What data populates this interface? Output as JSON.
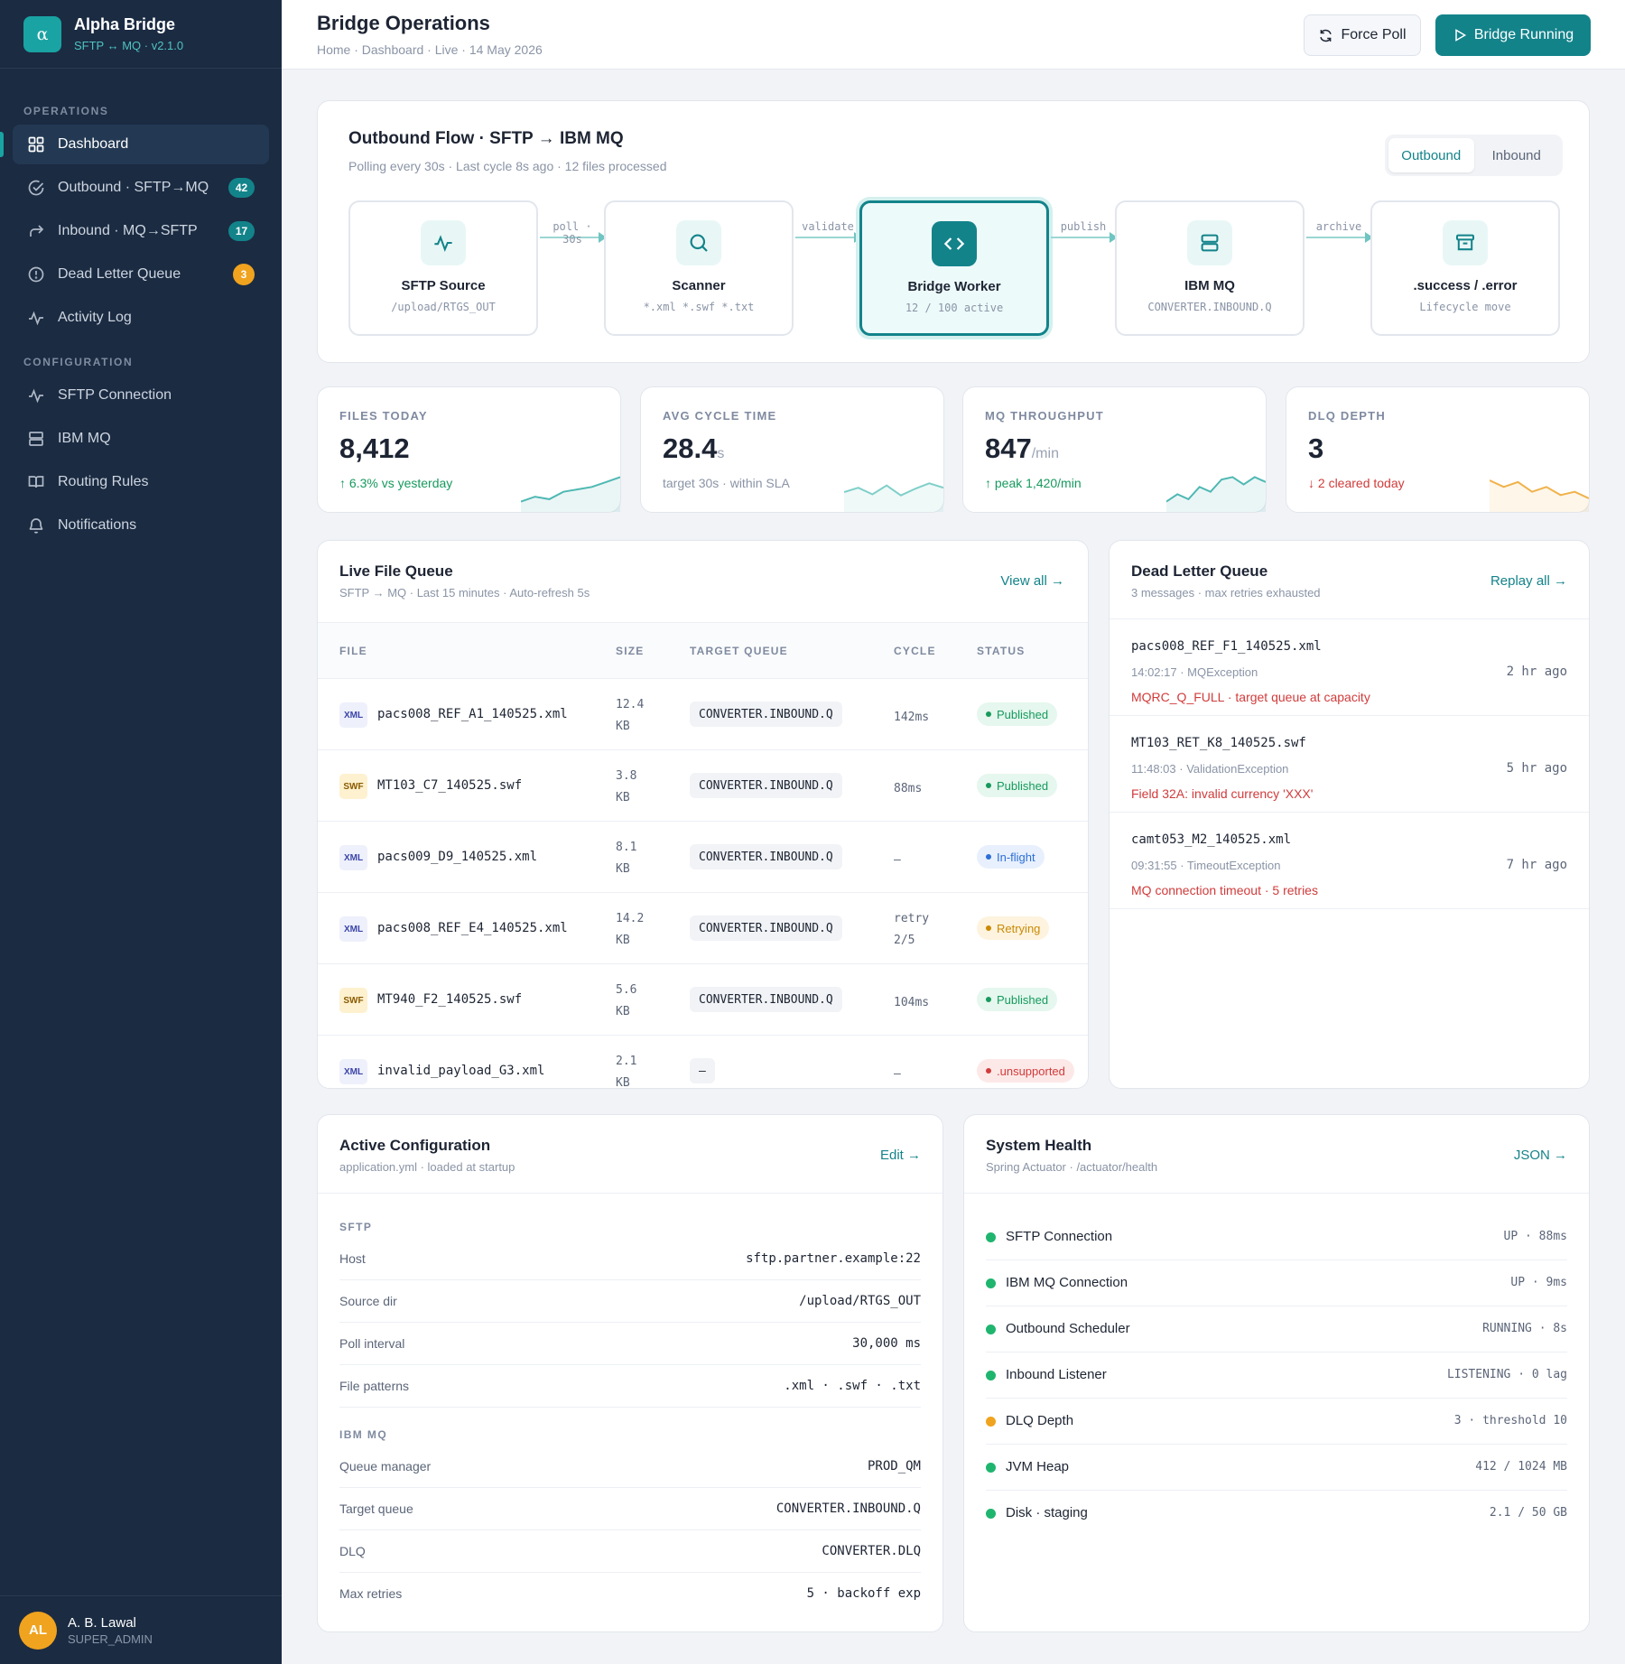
{
  "app": {
    "logo_glyph": "α",
    "name": "Alpha Bridge",
    "subtitle": "SFTP ↔ MQ · v2.1.0"
  },
  "sidebar": {
    "sections": [
      {
        "title": "OPERATIONS",
        "items": [
          {
            "label": "Dashboard",
            "icon": "grid-icon",
            "active": true
          },
          {
            "label": "Outbound · SFTP→MQ",
            "icon": "check-circle-icon",
            "badge": "42"
          },
          {
            "label": "Inbound · MQ→SFTP",
            "icon": "forward-arrow-icon",
            "badge": "17"
          },
          {
            "label": "Dead Letter Queue",
            "icon": "alert-circle-icon",
            "badge": "3"
          },
          {
            "label": "Activity Log",
            "icon": "activity-icon"
          }
        ]
      },
      {
        "title": "CONFIGURATION",
        "items": [
          {
            "label": "SFTP Connection",
            "icon": "pulse-icon"
          },
          {
            "label": "IBM MQ",
            "icon": "server-icon"
          },
          {
            "label": "Routing Rules",
            "icon": "book-icon"
          },
          {
            "label": "Notifications",
            "icon": "bell-icon"
          }
        ]
      }
    ],
    "user": {
      "initials": "AL",
      "name": "A. B. Lawal",
      "role": "SUPER_ADMIN"
    }
  },
  "header": {
    "title": "Bridge Operations",
    "breadcrumb": "Home · Dashboard · Live · 14 May 2026",
    "force_poll_label": "Force Poll",
    "running_label": "Bridge Running"
  },
  "flow": {
    "title": "Outbound Flow · SFTP → IBM MQ",
    "subtitle": "Polling every 30s · Last cycle 8s ago · 12 files processed",
    "toggle": {
      "outbound": "Outbound",
      "inbound": "Inbound",
      "selected": "Outbound"
    },
    "nodes": [
      {
        "name": "SFTP Source",
        "sub": "/upload/RTGS_OUT",
        "icon": "activity-icon"
      },
      {
        "name": "Scanner",
        "sub": "*.xml *.swf *.txt",
        "icon": "search-icon"
      },
      {
        "name": "Bridge Worker",
        "sub": "12 / 100 active",
        "icon": "code-icon"
      },
      {
        "name": "IBM MQ",
        "sub": "CONVERTER.INBOUND.Q",
        "icon": "server-icon"
      },
      {
        "name": ".success / .error",
        "sub": "Lifecycle move",
        "icon": "archive-icon"
      }
    ],
    "edges": [
      "poll · 30s",
      "validate",
      "publish",
      "archive"
    ]
  },
  "kpis": [
    {
      "label": "FILES TODAY",
      "value": "8,412",
      "unit": "",
      "note": "↑ 6.3% vs yesterday",
      "note_color": "#169a5d",
      "spark_color": "#4fb8b3",
      "spark": [
        3,
        4,
        3.5,
        5,
        5.5,
        6,
        7,
        8
      ]
    },
    {
      "label": "AVG CYCLE TIME",
      "value": "28.4",
      "unit": "s",
      "note": "target 30s · within SLA",
      "note_color": "#8a94a6",
      "spark_color": "#7fcfc9",
      "spark": [
        5,
        5.4,
        4.8,
        5.6,
        4.7,
        5.3,
        5.8,
        5.4
      ]
    },
    {
      "label": "MQ THROUGHPUT",
      "value": "847",
      "unit": "/min",
      "note": "↑ peak 1,420/min",
      "note_color": "#169a5d",
      "spark_color": "#4fb8b3",
      "spark": [
        3,
        4.5,
        3.5,
        6,
        5,
        7.5,
        8,
        6.5,
        8,
        7
      ]
    },
    {
      "label": "DLQ DEPTH",
      "value": "3",
      "unit": "",
      "note": "↓ 2 cleared today",
      "note_color": "#d13b3b",
      "spark_color": "#f0b24a",
      "spark": [
        6,
        5.2,
        5.8,
        4.6,
        5.2,
        4.2,
        4.6,
        3.8
      ]
    }
  ],
  "queue": {
    "title": "Live File Queue",
    "subtitle": "SFTP → MQ · Last 15 minutes · Auto-refresh 5s",
    "link": "View all →",
    "columns": [
      "FILE",
      "SIZE",
      "TARGET QUEUE",
      "CYCLE",
      "STATUS"
    ],
    "rows": [
      {
        "type": "XML",
        "file": "pacs008_REF_A1_140525.xml",
        "size1": "12.4",
        "size2": "KB",
        "queue": "CONVERTER.INBOUND.Q",
        "cycle1": "142ms",
        "cycle2": "",
        "status": "Published",
        "status_class": "published"
      },
      {
        "type": "SWF",
        "file": "MT103_C7_140525.swf",
        "size1": "3.8",
        "size2": "KB",
        "queue": "CONVERTER.INBOUND.Q",
        "cycle1": "88ms",
        "cycle2": "",
        "status": "Published",
        "status_class": "published"
      },
      {
        "type": "XML",
        "file": "pacs009_D9_140525.xml",
        "size1": "8.1",
        "size2": "KB",
        "queue": "CONVERTER.INBOUND.Q",
        "cycle1": "—",
        "cycle2": "",
        "status": "In-flight",
        "status_class": "inflight"
      },
      {
        "type": "XML",
        "file": "pacs008_REF_E4_140525.xml",
        "size1": "14.2",
        "size2": "KB",
        "queue": "CONVERTER.INBOUND.Q",
        "cycle1": "retry",
        "cycle2": "2/5",
        "status": "Retrying",
        "status_class": "retrying"
      },
      {
        "type": "SWF",
        "file": "MT940_F2_140525.swf",
        "size1": "5.6",
        "size2": "KB",
        "queue": "CONVERTER.INBOUND.Q",
        "cycle1": "104ms",
        "cycle2": "",
        "status": "Published",
        "status_class": "published"
      },
      {
        "type": "XML",
        "file": "invalid_payload_G3.xml",
        "size1": "2.1",
        "size2": "KB",
        "queue": "—",
        "cycle1": "—",
        "cycle2": "",
        "status": ".unsupported",
        "status_class": "unsupported"
      }
    ]
  },
  "dlq": {
    "title": "Dead Letter Queue",
    "subtitle": "3 messages · max retries exhausted",
    "link": "Replay all →",
    "items": [
      {
        "file": "pacs008_REF_F1_140525.xml",
        "meta": "14:02:17 · MQException",
        "error": "MQRC_Q_FULL · target queue at capacity",
        "age": "2 hr ago"
      },
      {
        "file": "MT103_RET_K8_140525.swf",
        "meta": "11:48:03 · ValidationException",
        "error": "Field 32A: invalid currency 'XXX'",
        "age": "5 hr ago"
      },
      {
        "file": "camt053_M2_140525.xml",
        "meta": "09:31:55 · TimeoutException",
        "error": "MQ connection timeout · 5 retries",
        "age": "7 hr ago"
      }
    ]
  },
  "config": {
    "title": "Active Configuration",
    "subtitle": "application.yml · loaded at startup",
    "link": "Edit →",
    "sftp_title": "SFTP",
    "sftp": [
      {
        "key": "Host",
        "value": "sftp.partner.example:22"
      },
      {
        "key": "Source dir",
        "value": "/upload/RTGS_OUT"
      },
      {
        "key": "Poll interval",
        "value": "30,000 ms"
      },
      {
        "key": "File patterns",
        "value": ".xml · .swf · .txt"
      }
    ],
    "mq_title": "IBM MQ",
    "mq": [
      {
        "key": "Queue manager",
        "value": "PROD_QM"
      },
      {
        "key": "Target queue",
        "value": "CONVERTER.INBOUND.Q"
      },
      {
        "key": "DLQ",
        "value": "CONVERTER.DLQ"
      },
      {
        "key": "Max retries",
        "value": "5 · backoff exp"
      }
    ]
  },
  "health": {
    "title": "System Health",
    "subtitle": "Spring Actuator · /actuator/health",
    "link": "JSON →",
    "items": [
      {
        "name": "SFTP Connection",
        "value": "UP · 88ms",
        "color": "#1fb56f"
      },
      {
        "name": "IBM MQ Connection",
        "value": "UP · 9ms",
        "color": "#1fb56f"
      },
      {
        "name": "Outbound Scheduler",
        "value": "RUNNING · 8s",
        "color": "#1fb56f"
      },
      {
        "name": "Inbound Listener",
        "value": "LISTENING · 0 lag",
        "color": "#1fb56f"
      },
      {
        "name": "DLQ Depth",
        "value": "3 · threshold 10",
        "color": "#f0a31e"
      },
      {
        "name": "JVM Heap",
        "value": "412 / 1024 MB",
        "color": "#1fb56f"
      },
      {
        "name": "Disk · staging",
        "value": "2.1 / 50 GB",
        "color": "#1fb56f"
      }
    ]
  }
}
